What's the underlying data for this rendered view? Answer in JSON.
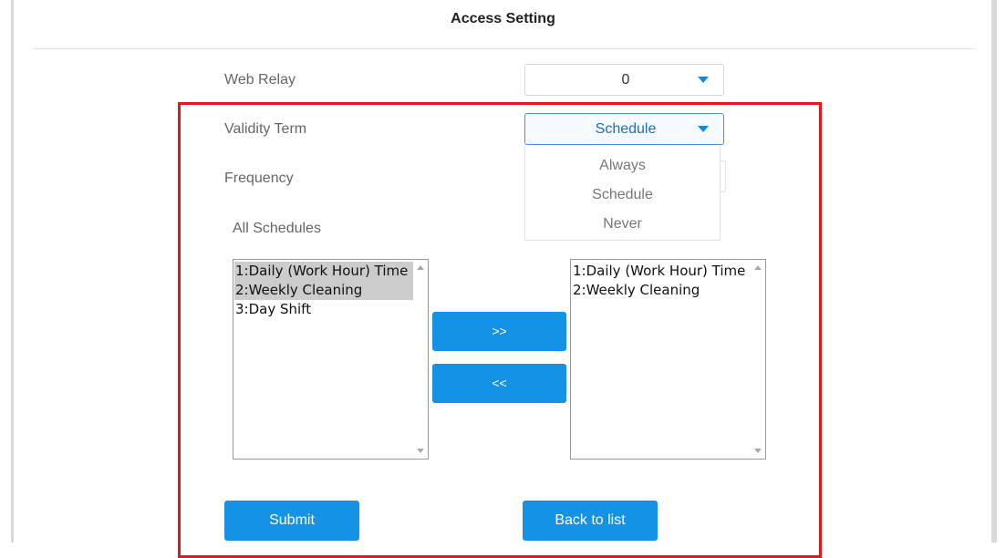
{
  "header": {
    "title": "Access Setting"
  },
  "web_relay": {
    "label": "Web Relay",
    "value": "0"
  },
  "validity_term": {
    "label": "Validity Term",
    "value": "Schedule",
    "options": [
      "Always",
      "Schedule",
      "Never"
    ]
  },
  "frequency": {
    "label": "Frequency"
  },
  "schedules": {
    "label": "All Schedules",
    "available": [
      "1:Daily (Work Hour) Time",
      "2:Weekly Cleaning",
      "3:Day Shift"
    ],
    "selected": [
      "1:Daily (Work Hour) Time",
      "2:Weekly Cleaning"
    ],
    "add_label": ">>",
    "remove_label": "<<"
  },
  "actions": {
    "submit_label": "Submit",
    "back_label": "Back to list"
  },
  "colors": {
    "accent": "#1492e6",
    "highlight_frame": "#e8141b"
  }
}
